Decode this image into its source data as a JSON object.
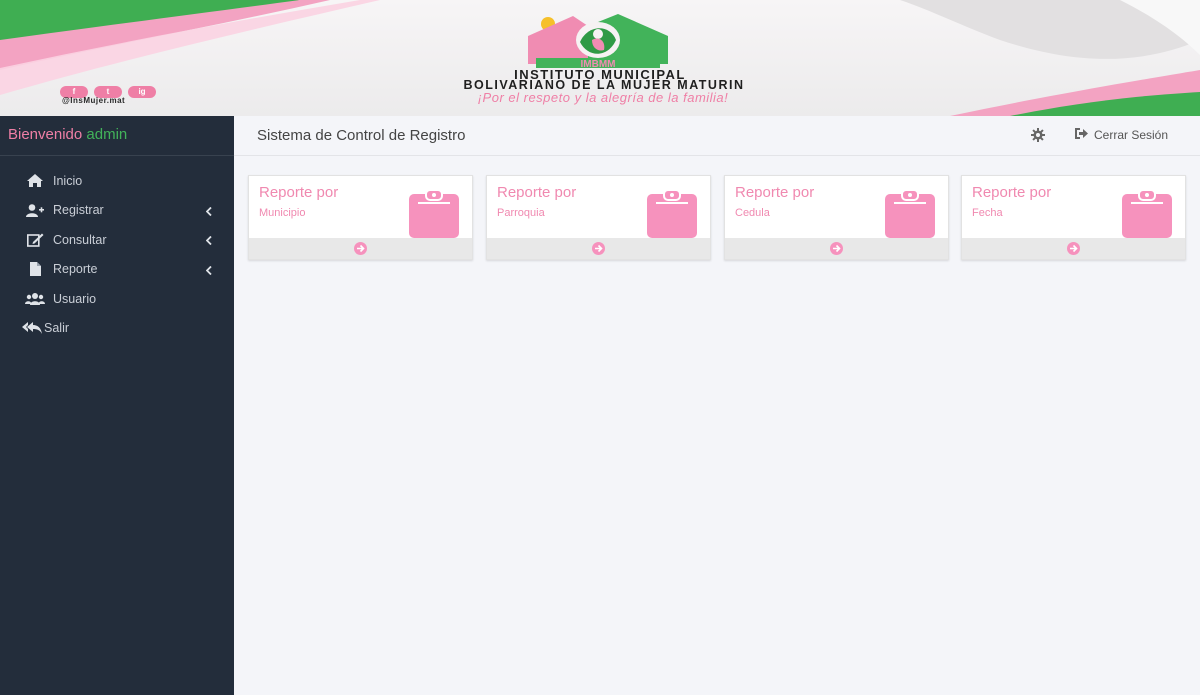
{
  "banner": {
    "social": [
      "f",
      "t",
      "ig"
    ],
    "handle": "@InsMujer.mat",
    "logo_text": "IMBMM",
    "institute_line1": "INSTITUTO MUNICIPAL",
    "institute_line2": "BOLIVARIANO DE LA MUJER MATURIN",
    "motto": "¡Por el respeto y la alegría de la familia!"
  },
  "sidebar": {
    "welcome": "Bienvenido",
    "user": "admin",
    "items": [
      {
        "label": "Inicio",
        "icon": "home-icon"
      },
      {
        "label": "Registrar",
        "icon": "user-plus-icon"
      },
      {
        "label": "Consultar",
        "icon": "edit-icon"
      },
      {
        "label": "Reporte",
        "icon": "file-icon"
      },
      {
        "label": "Usuario",
        "icon": "users-icon"
      },
      {
        "label": "Salir",
        "icon": "reply-all-icon"
      }
    ]
  },
  "header": {
    "title": "Sistema de Control de Registro",
    "logout": "Cerrar Sesión"
  },
  "cards": [
    {
      "title": "Reporte por",
      "subtitle": "Municipio"
    },
    {
      "title": "Reporte por",
      "subtitle": "Parroquia"
    },
    {
      "title": "Reporte por",
      "subtitle": "Cedula"
    },
    {
      "title": "Reporte por",
      "subtitle": "Fecha"
    }
  ],
  "colors": {
    "pink": "#ef7fa6",
    "green": "#42b35a",
    "sidebar": "#232d3b"
  }
}
